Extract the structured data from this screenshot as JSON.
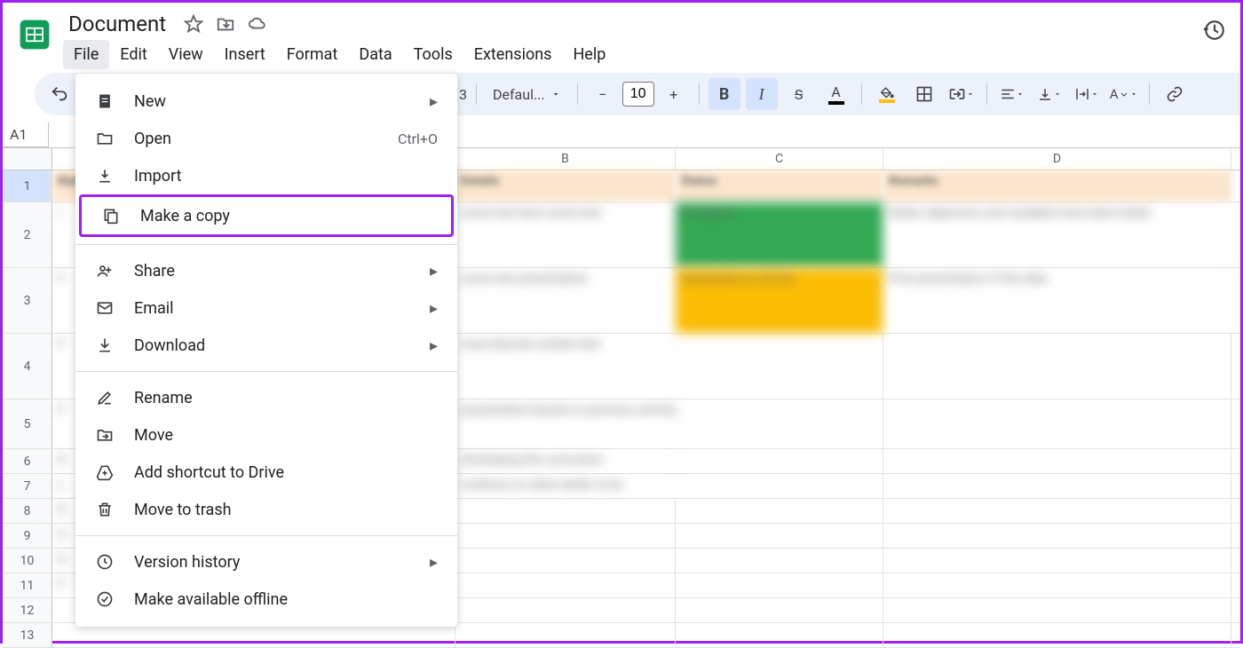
{
  "doc": {
    "title": "Document"
  },
  "menubar": [
    "File",
    "Edit",
    "View",
    "Insert",
    "Format",
    "Data",
    "Tools",
    "Extensions",
    "Help"
  ],
  "toolbar": {
    "zoom_trailing_digit": "3",
    "font_name": "Defaul...",
    "font_size": "10"
  },
  "name_box": "A1",
  "columns": [
    "B",
    "C",
    "D"
  ],
  "rows": [
    "1",
    "2",
    "3",
    "4",
    "5",
    "6",
    "7",
    "8",
    "9",
    "10",
    "11",
    "12",
    "13"
  ],
  "file_menu": {
    "new": "New",
    "open": "Open",
    "open_shortcut": "Ctrl+O",
    "import": "Import",
    "make_copy": "Make a copy",
    "share": "Share",
    "email": "Email",
    "download": "Download",
    "rename": "Rename",
    "move": "Move",
    "add_shortcut": "Add shortcut to Drive",
    "trash": "Move to trash",
    "version_history": "Version history",
    "offline": "Make available offline"
  }
}
